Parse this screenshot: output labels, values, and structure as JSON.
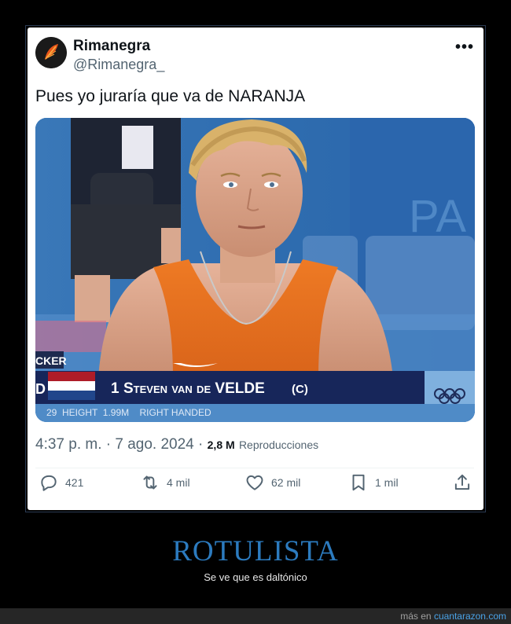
{
  "tweet": {
    "display_name": "Rimanegra",
    "handle": "@Rimanegra_",
    "more_icon": "more-dots-icon",
    "text": "Pues yo juraría que va de NARANJA",
    "image": {
      "caption_number": "1",
      "caption_name": "Steven van de VELDE",
      "caption_suffix": "(C)",
      "partial_left_label": "CKER",
      "partial_flag_letter": "D",
      "stats_line": "29  HEIGHT  1.99M    RIGHT HANDED",
      "background_text": "PA",
      "flag_colors": [
        "#ae1c28",
        "#ffffff",
        "#21468b"
      ],
      "jersey_color": "#e8731e"
    },
    "timestamp": "4:37 p. m. · 7 ago. 2024",
    "views_count": "2,8 M",
    "views_label": "Reproducciones",
    "actions": {
      "reply": {
        "icon": "reply-icon",
        "count": "421"
      },
      "retweet": {
        "icon": "retweet-icon",
        "count": "4 mil"
      },
      "like": {
        "icon": "heart-icon",
        "count": "62 mil"
      },
      "bookmark": {
        "icon": "bookmark-icon",
        "count": "1 mil"
      },
      "share": {
        "icon": "share-icon"
      }
    }
  },
  "banner": {
    "title": "ROTULISTA",
    "subtitle": "Se ve que es daltónico"
  },
  "footer": {
    "prefix": "más en",
    "link": "cuantarazon.com"
  },
  "colors": {
    "accent": "#2c7bbf",
    "link": "#4aa3e8",
    "page_bg": "#000000",
    "card_bg": "#ffffff"
  }
}
